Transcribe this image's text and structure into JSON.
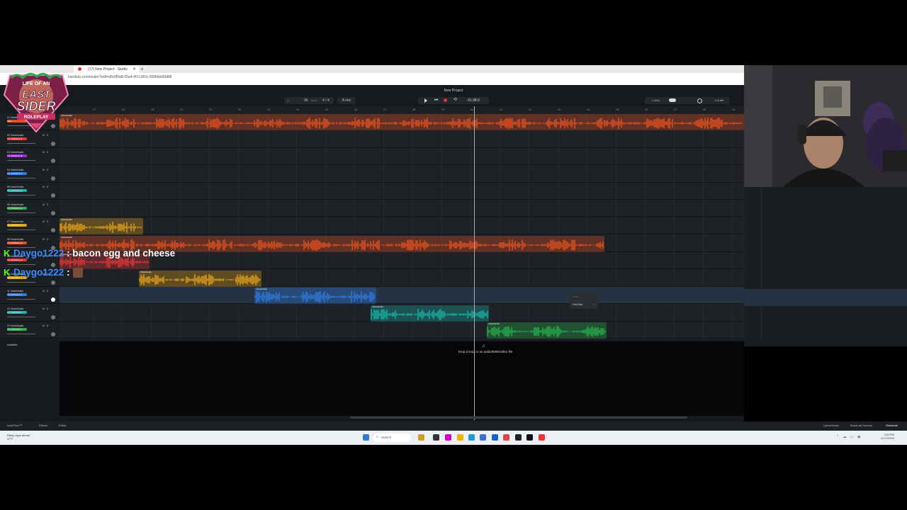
{
  "browser": {
    "tab_title": "(17) New Project · Studio",
    "url": "bandlab.com/studio?edit=d9c0f0a8-05a4-4f11-8f1b-008b9a95b88f",
    "new_tab_icon": "plus-icon",
    "close_tab_icon": "close-icon"
  },
  "daw": {
    "project_title": "New Project",
    "tempo": "96",
    "tempo_unit": "bpm",
    "time_signature": "4 / 4",
    "key": "A min",
    "time_display": "01:38.0",
    "clarity_label": "Clarity",
    "master_db": "-1.6 dB",
    "ruler_ticks": [
      "27",
      "28",
      "29",
      "30",
      "31",
      "32",
      "33",
      "34",
      "35",
      "36",
      "37",
      "38",
      "39",
      "40",
      "41",
      "42",
      "43",
      "44",
      "45",
      "46",
      "47",
      "48",
      "49"
    ],
    "tracks": [
      {
        "num": "01 Voice/Audio",
        "instrument": "Beat",
        "color": "#e3511f"
      },
      {
        "num": "02 Voice/Audio",
        "instrument": "FX_VOCALS_A",
        "color": "#e23636"
      },
      {
        "num": "03 Voice/Audio",
        "instrument": "FX_VOCALS_B",
        "color": "#9b30d9"
      },
      {
        "num": "04 Voice/Audio",
        "instrument": "FX_VOCALS_C",
        "color": "#2f7be0"
      },
      {
        "num": "05 Voice/Audio",
        "instrument": "FX_VOCALS_D",
        "color": "#19b3a6"
      },
      {
        "num": "06 Voice/Audio",
        "instrument": "FX_VOCALS_E",
        "color": "#26b04a"
      },
      {
        "num": "07 Voice/Audio",
        "instrument": "FX_VOCALS_F",
        "color": "#e0a21c"
      },
      {
        "num": "08 Voice/Audio",
        "instrument": "FX_VOCALS_G",
        "color": "#e3511f"
      },
      {
        "num": "09 Voice/Audio",
        "instrument": "FX_VOCALS_H",
        "color": "#e23636"
      },
      {
        "num": "10 Voice/Audio",
        "instrument": "FX_VOCALS_I",
        "color": "#e0a21c"
      },
      {
        "num": "11 Voice/Audio",
        "instrument": "FX_VOCALS_J",
        "color": "#2f7be0"
      },
      {
        "num": "12 Voice/Audio",
        "instrument": "FX_VOCALS_K",
        "color": "#19b3a6"
      },
      {
        "num": "13 Voice/Audio",
        "instrument": "FX_VOCALS_L",
        "color": "#26b04a"
      }
    ],
    "track_ms": "M S",
    "autofill_label": "AutoMix",
    "clip_label": "Voice/Audio",
    "drop_text": "Drop a loop or an audio/MIDI/video file",
    "context_menu": {
      "paste": "Paste",
      "grid_size": "Grid Size"
    },
    "bottom_bar": {
      "autopitch": "AutoPitch™",
      "effects": "Effects",
      "editor": "Editor",
      "lyrics": "Lyrics/Notes",
      "sounds": "BandLab Sounds",
      "shortcuts": "Shortcuts"
    },
    "colors": {
      "orange": "#e3511f",
      "red": "#e23636",
      "yellow": "#e0a21c",
      "blue": "#2f7be0",
      "teal": "#19b3a6",
      "green": "#26b04a"
    }
  },
  "taskbar": {
    "weather_line1": "Rainy days ahead",
    "weather_line2": "47°F",
    "search_placeholder": "Search",
    "time": "3:43 PM",
    "date": "11/17/2024"
  },
  "chat": [
    {
      "platform_icon": "K",
      "user": "Daygo1222",
      "message": ": bacon egg and cheese"
    },
    {
      "platform_icon": "K",
      "user": "Daygo1222",
      "message": ":"
    }
  ],
  "logo": {
    "line1": "LIFE OF AN",
    "line2": "EAST",
    "line3": "SIDER",
    "line4": "ROLEPLAY"
  }
}
